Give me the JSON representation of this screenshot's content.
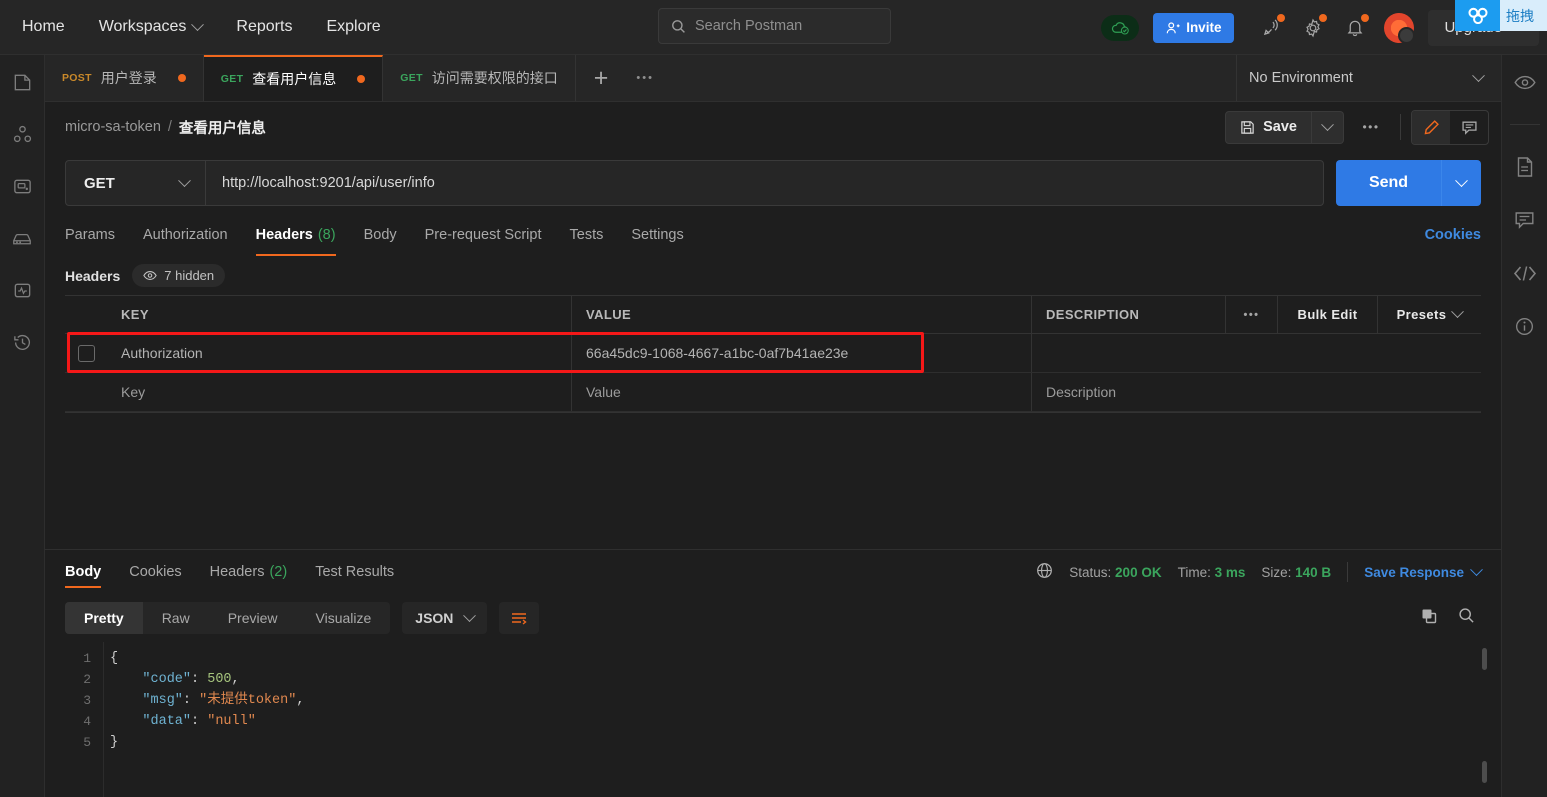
{
  "topbar": {
    "nav": [
      {
        "label": "Home",
        "icon": "home-nav"
      },
      {
        "label": "Workspaces",
        "icon": "chevron-down-icon"
      },
      {
        "label": "Reports",
        "icon": ""
      },
      {
        "label": "Explore",
        "icon": ""
      }
    ],
    "search_placeholder": "Search Postman",
    "invite_label": "Invite",
    "upgrade_label": "Upgrade",
    "icons": [
      "cloud-sync-icon",
      "invite-person-icon",
      "satellite-icon",
      "gear-icon",
      "bell-icon",
      "avatar"
    ]
  },
  "float_widget": {
    "text": "拖拽",
    "logo": "app-logo-icon",
    "accent": "#1c9cf0"
  },
  "left_rail": [
    "collections-icon",
    "apis-icon",
    "environments-icon",
    "mock-servers-icon",
    "monitors-icon",
    "history-icon"
  ],
  "right_rail": [
    "eye-preview-icon",
    "documentation-icon",
    "comments-icon",
    "code-snippet-icon",
    "info-icon"
  ],
  "tabs": {
    "items": [
      {
        "method": "POST",
        "name": "用户登录",
        "dirty": true,
        "active": false
      },
      {
        "method": "GET",
        "name": "查看用户信息",
        "dirty": true,
        "active": true
      },
      {
        "method": "GET",
        "name": "访问需要权限的接口",
        "dirty": false,
        "active": false
      }
    ],
    "new_tab": "+",
    "more": "•••",
    "environment": "No Environment"
  },
  "breadcrumb": {
    "collection": "micro-sa-token",
    "separator": "/",
    "request": "查看用户信息"
  },
  "actions": {
    "save_label": "Save",
    "more": "•••",
    "save_icon": "floppy-disk-icon",
    "edit_icon": "pencil-icon",
    "comment_icon": "comment-icon"
  },
  "url_bar": {
    "method": "GET",
    "url": "http://localhost:9201/api/user/info",
    "send_label": "Send"
  },
  "request_tabs": {
    "items": [
      {
        "label": "Params",
        "count": "",
        "active": false
      },
      {
        "label": "Authorization",
        "count": "",
        "active": false
      },
      {
        "label": "Headers",
        "count": "(8)",
        "active": true
      },
      {
        "label": "Body",
        "count": "",
        "active": false
      },
      {
        "label": "Pre-request Script",
        "count": "",
        "active": false
      },
      {
        "label": "Tests",
        "count": "",
        "active": false
      },
      {
        "label": "Settings",
        "count": "",
        "active": false
      }
    ],
    "cookies_link": "Cookies"
  },
  "headers_panel": {
    "title": "Headers",
    "hidden_badge": "7 hidden",
    "hidden_icon": "eye-icon",
    "columns": [
      "KEY",
      "VALUE",
      "DESCRIPTION"
    ],
    "dots": "•••",
    "bulk_edit": "Bulk Edit",
    "presets": "Presets",
    "rows": [
      {
        "key": "Authorization",
        "value": "66a45dc9-1068-4667-a1bc-0af7b41ae23e",
        "description": "",
        "checked": false,
        "highlighted": true
      },
      {
        "key": "Key",
        "value": "Value",
        "description": "Description",
        "checked": false,
        "highlighted": false
      }
    ],
    "highlight_color": "#f51818"
  },
  "response": {
    "tabs": [
      {
        "label": "Body",
        "count": "",
        "active": true
      },
      {
        "label": "Cookies",
        "count": "",
        "active": false
      },
      {
        "label": "Headers",
        "count": "(2)",
        "active": false
      },
      {
        "label": "Test Results",
        "count": "",
        "active": false
      }
    ],
    "status_label": "Status:",
    "status_value": "200 OK",
    "time_label": "Time:",
    "time_value": "3 ms",
    "size_label": "Size:",
    "size_value": "140 B",
    "save_response": "Save Response",
    "globe_icon": "globe-icon",
    "view_modes": [
      {
        "label": "Pretty",
        "active": true
      },
      {
        "label": "Raw",
        "active": false
      },
      {
        "label": "Preview",
        "active": false
      },
      {
        "label": "Visualize",
        "active": false
      }
    ],
    "format": "JSON",
    "wrap_icon": "word-wrap-icon",
    "copy_icon": "copy-icon",
    "search_icon": "search-icon",
    "body_lines": [
      {
        "n": "1",
        "tokens": [
          {
            "t": "{",
            "c": "brace"
          }
        ]
      },
      {
        "n": "2",
        "tokens": [
          {
            "t": "    ",
            "c": "p"
          },
          {
            "t": "\"code\"",
            "c": "k"
          },
          {
            "t": ": ",
            "c": "p"
          },
          {
            "t": "500",
            "c": "n"
          },
          {
            "t": ",",
            "c": "p"
          }
        ]
      },
      {
        "n": "3",
        "tokens": [
          {
            "t": "    ",
            "c": "p"
          },
          {
            "t": "\"msg\"",
            "c": "k"
          },
          {
            "t": ": ",
            "c": "p"
          },
          {
            "t": "\"未提供token\"",
            "c": "s"
          },
          {
            "t": ",",
            "c": "p"
          }
        ]
      },
      {
        "n": "4",
        "tokens": [
          {
            "t": "    ",
            "c": "p"
          },
          {
            "t": "\"data\"",
            "c": "k"
          },
          {
            "t": ": ",
            "c": "p"
          },
          {
            "t": "\"null\"",
            "c": "s"
          }
        ]
      },
      {
        "n": "5",
        "tokens": [
          {
            "t": "}",
            "c": "brace"
          }
        ]
      }
    ]
  }
}
